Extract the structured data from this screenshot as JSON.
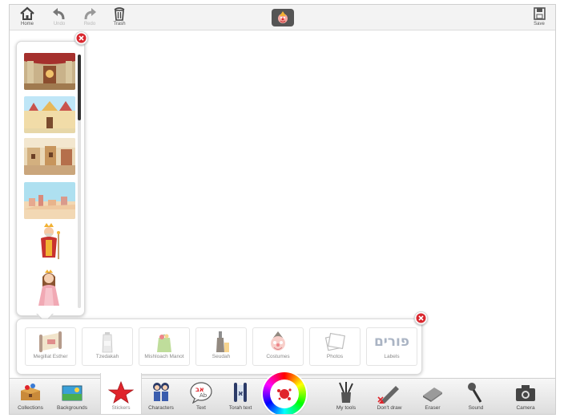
{
  "topbar": {
    "home_label": "Home",
    "undo_label": "Undo",
    "redo_label": "Redo",
    "trash_label": "Trash",
    "save_label": "Save"
  },
  "sticker_panel": {
    "items": [
      "palace-scene",
      "palace-exterior-scene",
      "town-street-scene",
      "city-skyline-scene",
      "king-character",
      "queen-character"
    ]
  },
  "categories": [
    {
      "label": "Megillat Esther",
      "icon": "scroll-icon"
    },
    {
      "label": "Tzedakah",
      "icon": "tzedakah-box-icon"
    },
    {
      "label": "Mishloach Manot",
      "icon": "gift-bag-icon"
    },
    {
      "label": "Seudah",
      "icon": "wine-bottle-icon"
    },
    {
      "label": "Costumes",
      "icon": "clown-mask-icon"
    },
    {
      "label": "Photos",
      "icon": "photos-icon"
    },
    {
      "label": "Labels",
      "icon": "hebrew-label-icon",
      "text": "פורים"
    }
  ],
  "bottombar": {
    "collections": "Collections",
    "backgrounds": "Backgrounds",
    "stickers": "Stickers",
    "characters": "Characters",
    "text": "Text",
    "torah_text": "Torah text",
    "my_tools": "My tools",
    "dont_draw": "Don't draw",
    "eraser": "Eraser",
    "sound": "Sound",
    "camera": "Camera"
  },
  "colors": {
    "accent_red": "#e0242b",
    "close_red": "#d9282f",
    "toolbar_bg": "#f3f3f3"
  }
}
